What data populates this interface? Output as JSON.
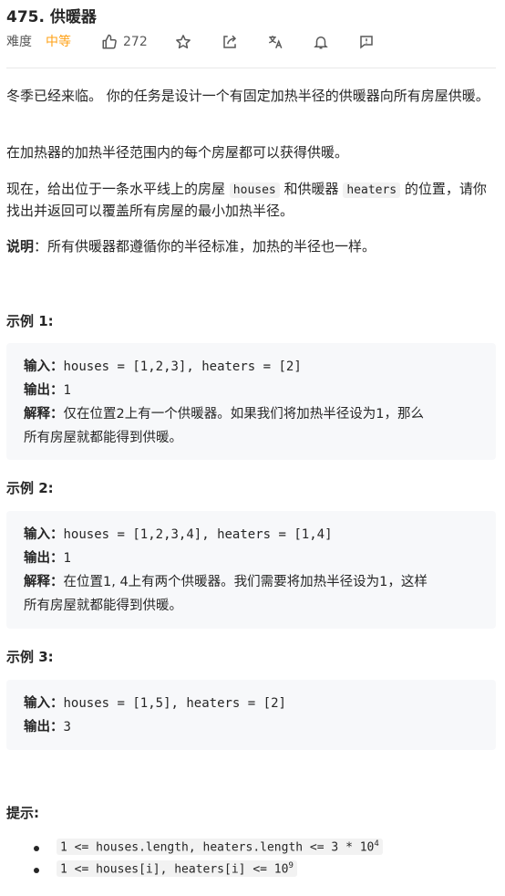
{
  "problem": {
    "title": "475. 供暖器",
    "difficulty_label": "难度",
    "difficulty": "中等",
    "likes": "272"
  },
  "icons": {
    "like": "thumbs-up-icon",
    "star": "star-icon",
    "share": "share-icon",
    "translate": "translate-icon",
    "bell": "bell-icon",
    "feedback": "feedback-icon"
  },
  "colors": {
    "difficulty": "#ffa116",
    "text": "#262626",
    "box_bg": "#f7f8fa"
  },
  "description": {
    "p1": "冬季已经来临。 你的任务是设计一个有固定加热半径的供暖器向所有房屋供暖。",
    "p2": "在加热器的加热半径范围内的每个房屋都可以获得供暖。",
    "p3_a": "现在，给出位于一条水平线上的房屋",
    "p3_code1": "houses",
    "p3_b": "和供暖器",
    "p3_code2": "heaters",
    "p3_c": "的位置，请你找出并返回可以覆盖所有房屋的最小加热半径。",
    "note_label": "说明",
    "note_text": "：所有供暖器都遵循你的半径标准，加热的半径也一样。"
  },
  "examples": [
    {
      "title": "示例 1:",
      "input_label": "输入：",
      "input": "houses = [1,2,3], heaters = [2]",
      "output_label": "输出：",
      "output": "1",
      "explain_label": "解释：",
      "explain_1": "仅在位置2上有一个供暖器。如果我们将加热半径设为1，那么",
      "explain_2": "所有房屋就都能得到供暖。"
    },
    {
      "title": "示例 2:",
      "input_label": "输入：",
      "input": "houses = [1,2,3,4], heaters = [1,4]",
      "output_label": "输出：",
      "output": "1",
      "explain_label": "解释：",
      "explain_1": "在位置1, 4上有两个供暖器。我们需要将加热半径设为1，这样",
      "explain_2": "所有房屋就都能得到供暖。"
    },
    {
      "title": "示例 3:",
      "input_label": "输入：",
      "input": "houses = [1,5], heaters = [2]",
      "output_label": "输出：",
      "output": "3"
    }
  ],
  "hints": {
    "title": "提示:",
    "h1_text": "1 <= houses.length, heaters.length <= 3 * 10",
    "h1_sup": "4",
    "h2_text": "1 <= houses[i], heaters[i] <= 10",
    "h2_sup": "9"
  }
}
